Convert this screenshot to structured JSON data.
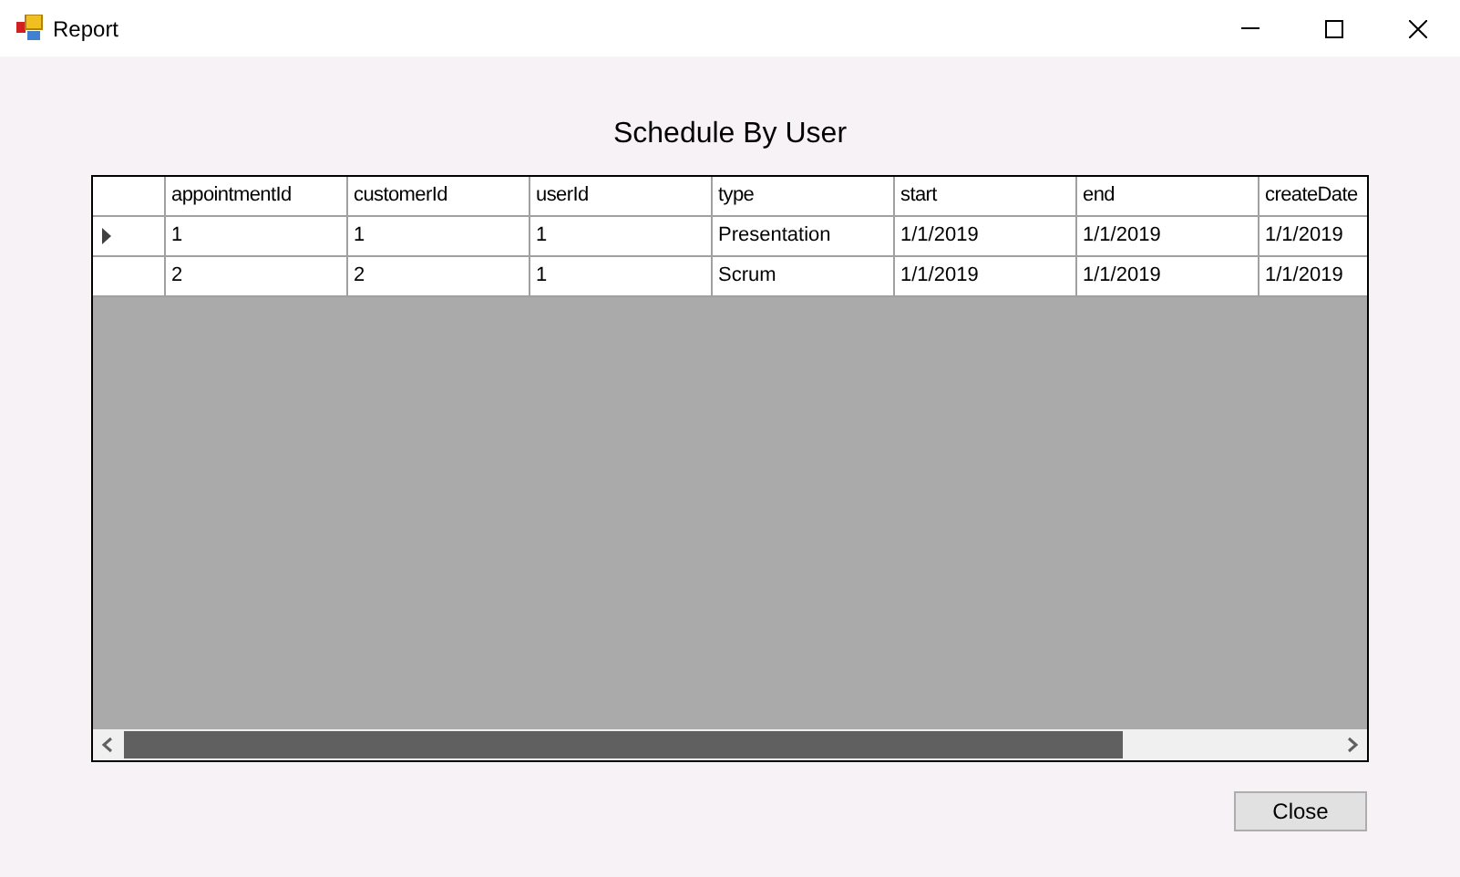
{
  "window": {
    "title": "Report"
  },
  "heading": "Schedule By User",
  "table": {
    "columns": [
      "appointmentId",
      "customerId",
      "userId",
      "type",
      "start",
      "end",
      "createDate"
    ],
    "rows": [
      {
        "current": true,
        "cells": [
          "1",
          "1",
          "1",
          "Presentation",
          "1/1/2019",
          "1/1/2019",
          "1/1/2019"
        ]
      },
      {
        "current": false,
        "cells": [
          "2",
          "2",
          "1",
          "Scrum",
          "1/1/2019",
          "1/1/2019",
          "1/1/2019"
        ]
      }
    ]
  },
  "buttons": [
    "Close"
  ]
}
